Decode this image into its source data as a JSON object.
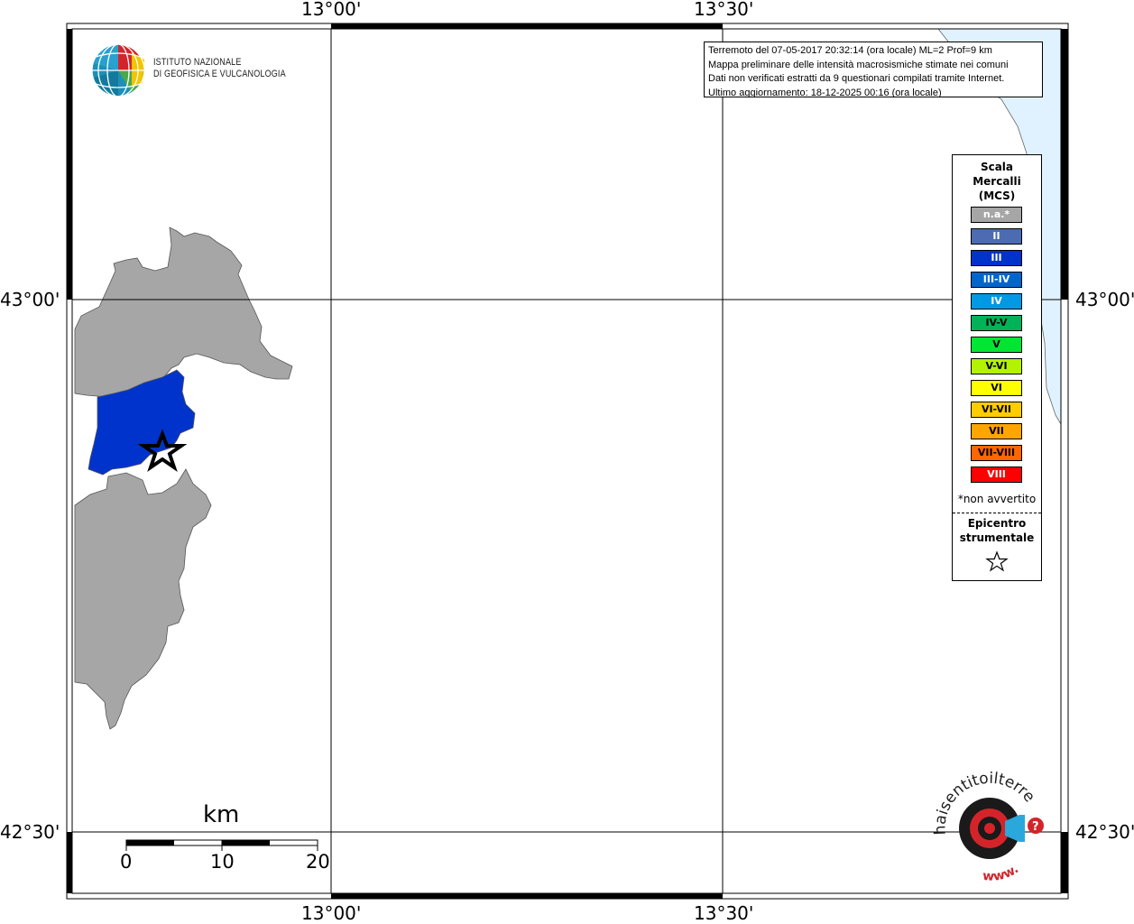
{
  "coords": {
    "lon_labels": [
      "13°00'",
      "13°30'"
    ],
    "lat_labels": [
      "43°00'",
      "42°30'"
    ]
  },
  "info": {
    "line1": "Terremoto del 07-05-2017 20:32:14 (ora locale) ML=2 Prof=9 km",
    "line2": "Mappa preliminare delle intensità macrosismiche stimate nei comuni",
    "line3": "Dati non verificati estratti da 9 questionari compilati tramite Internet.",
    "line4": "Ultimo aggiornamento: 18-12-2025 00:16 (ora locale)"
  },
  "ingv": {
    "line1": "ISTITUTO NAZIONALE",
    "line2": "DI GEOFISICA E VULCANOLOGIA"
  },
  "legend": {
    "title_lines": [
      "Scala",
      "Mercalli",
      "(MCS)"
    ],
    "items": [
      {
        "label": "n.a.*",
        "color": "#a6a6a6",
        "text_color": "#ffffff"
      },
      {
        "label": "II",
        "color": "#4c6bb2",
        "text_color": "#ffffff"
      },
      {
        "label": "III",
        "color": "#0033cc",
        "text_color": "#ffffff"
      },
      {
        "label": "III-IV",
        "color": "#0066cc",
        "text_color": "#ffffff"
      },
      {
        "label": "IV",
        "color": "#0099e6",
        "text_color": "#ffffff"
      },
      {
        "label": "IV-V",
        "color": "#00b359",
        "text_color": "#000000"
      },
      {
        "label": "V",
        "color": "#00e633",
        "text_color": "#000000"
      },
      {
        "label": "V-VI",
        "color": "#b3f200",
        "text_color": "#000000"
      },
      {
        "label": "VI",
        "color": "#ffff00",
        "text_color": "#000000"
      },
      {
        "label": "VI-VII",
        "color": "#ffcc00",
        "text_color": "#000000"
      },
      {
        "label": "VII",
        "color": "#ffa500",
        "text_color": "#000000"
      },
      {
        "label": "VII-VIII",
        "color": "#ff6600",
        "text_color": "#000000"
      },
      {
        "label": "VIII",
        "color": "#ff0000",
        "text_color": "#ffffff"
      }
    ],
    "note": "*non avvertito",
    "epicenter_lines": [
      "Epicentro",
      "strumentale"
    ]
  },
  "scale_bar": {
    "unit": "km",
    "ticks": [
      "0",
      "10",
      "20"
    ]
  },
  "map": {
    "municipality_intensity": "III",
    "municipality_color": "#0033cc",
    "land_color": "#a6a6a6",
    "sea_color": "#e0f2ff"
  },
  "brand": {
    "text_main": "haisentitoilterremoto.it",
    "text_www": "www."
  }
}
